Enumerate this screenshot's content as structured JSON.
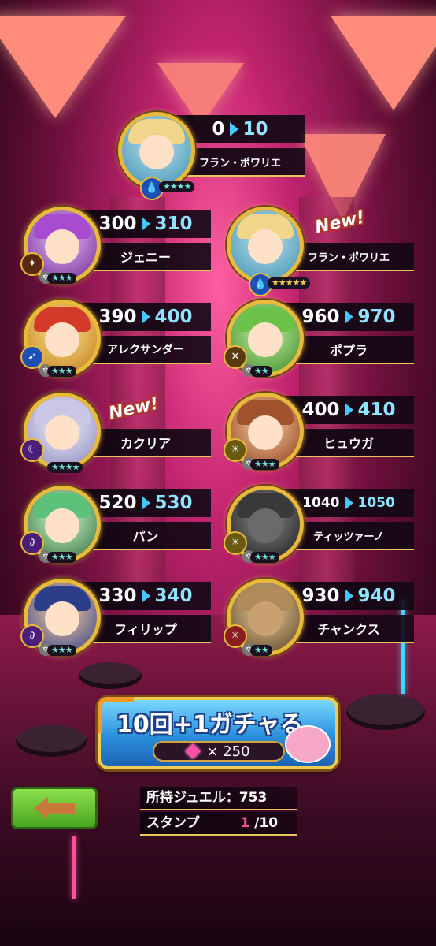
{
  "cards": [
    {
      "id": "furan1",
      "before": "0",
      "after": "10",
      "name": "フラン・ポワリエ",
      "element": "water-icon",
      "stars": "★★★★",
      "is_new": false,
      "color": "#f1d58a"
    },
    {
      "id": "jenny",
      "before": "300",
      "after": "310",
      "name": "ジェニー",
      "element": "dark-icon",
      "stars": "★★★",
      "is_new": false,
      "color": "#a84bd0"
    },
    {
      "id": "furan2",
      "before": "",
      "after": "",
      "name": "フラン・ポワリエ",
      "element": "water-icon",
      "stars": "★★★★★",
      "is_new": true,
      "new_label": "New!",
      "color": "#f1d58a"
    },
    {
      "id": "alexander",
      "before": "390",
      "after": "400",
      "name": "アレクサンダー",
      "element": "water-icon",
      "stars": "★★★",
      "is_new": false,
      "color": "#d43a2a"
    },
    {
      "id": "popura",
      "before": "960",
      "after": "970",
      "name": "ポプラ",
      "element": "earth-icon",
      "stars": "★★",
      "is_new": false,
      "color": "#6cc24a"
    },
    {
      "id": "kakuria",
      "before": "",
      "after": "",
      "name": "カクリア",
      "element": "water-icon",
      "stars": "★★★★",
      "is_new": true,
      "new_label": "New!",
      "color": "#c9c6e6"
    },
    {
      "id": "hyuuga",
      "before": "400",
      "after": "410",
      "name": "ヒュウガ",
      "element": "light-icon",
      "stars": "★★★",
      "is_new": false,
      "color": "#a0522d"
    },
    {
      "id": "pan",
      "before": "520",
      "after": "530",
      "name": "パン",
      "element": "dark-icon",
      "stars": "★★★",
      "is_new": false,
      "color": "#5cc27a"
    },
    {
      "id": "tizzy",
      "before": "1040",
      "after": "1050",
      "name": "ティッツァーノ",
      "element": "light-icon",
      "stars": "★★★",
      "is_new": false,
      "color": "#3a3a3a"
    },
    {
      "id": "philip",
      "before": "330",
      "after": "340",
      "name": "フィリップ",
      "element": "dark-icon",
      "stars": "★★★",
      "is_new": false,
      "color": "#2c3e8a"
    },
    {
      "id": "chunks",
      "before": "930",
      "after": "940",
      "name": "チャンクス",
      "element": "fire-icon",
      "stars": "★★",
      "is_new": false,
      "color": "#b08a5a"
    }
  ],
  "gacha": {
    "title": "10回+1ガチャる",
    "cost": "× 250",
    "icon": "gem-icon"
  },
  "info": {
    "jewel_label": "所持ジュエル：753",
    "stamp_label": "スタンプ",
    "stamp_current": "1",
    "stamp_total": "/10"
  },
  "back_icon": "back-arrow-icon"
}
